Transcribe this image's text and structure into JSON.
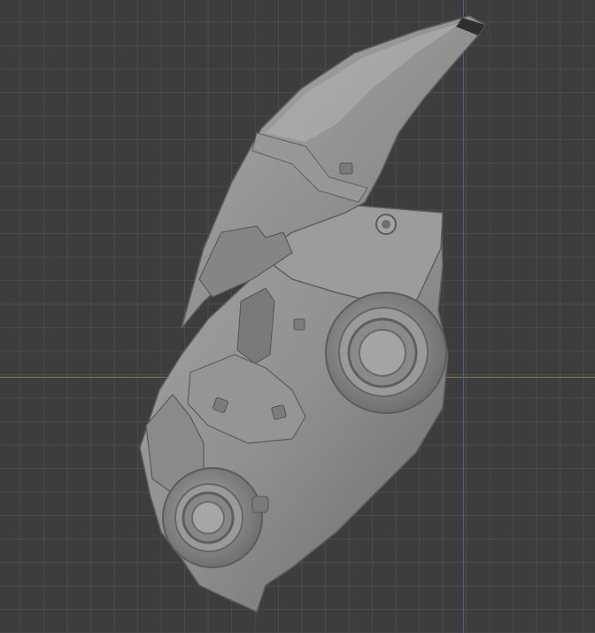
{
  "viewport": {
    "view": "3D Viewport",
    "background_color": "#3d3d3d",
    "grid_color": "#4a4a4a",
    "x_axis_color": "#6f8a3c",
    "y_axis_color": "#3f62a3"
  },
  "model": {
    "object": "sculpted-mask",
    "shading": "solid-matcap-gray",
    "base_color": "#8e8e8e",
    "highlight_color": "#b4b4b4",
    "shadow_color": "#5a5a5a"
  }
}
